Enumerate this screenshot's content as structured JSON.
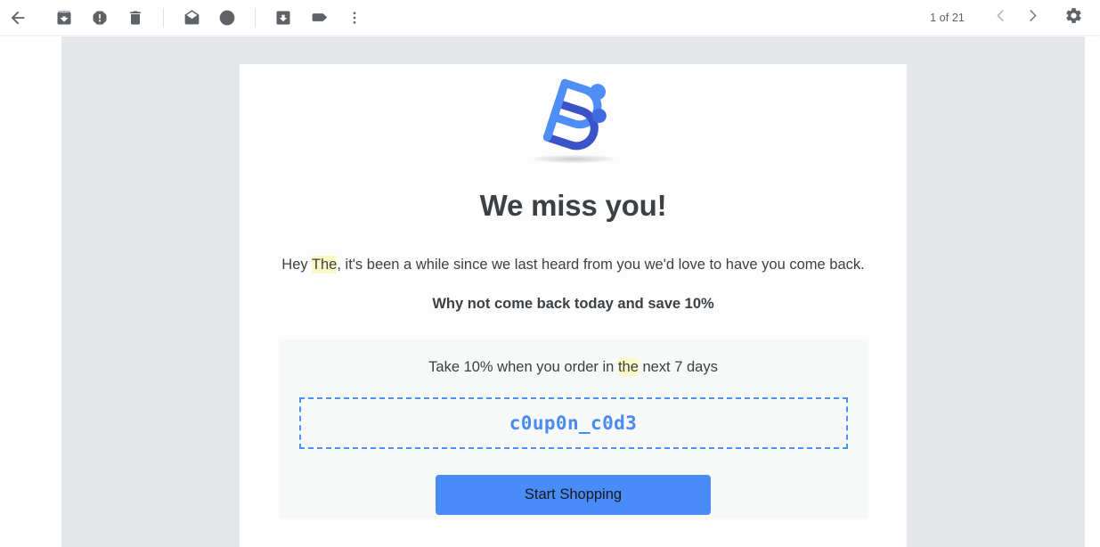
{
  "toolbar": {
    "back": {
      "label": "Back to Inbox",
      "icon": "arrow-left-icon"
    },
    "actions": [
      {
        "name": "archive",
        "label": "Archive",
        "icon": "archive-icon"
      },
      {
        "name": "report-spam",
        "label": "Report spam",
        "icon": "report-spam-icon"
      },
      {
        "name": "delete",
        "label": "Delete",
        "icon": "trash-icon"
      },
      {
        "name": "mark-unread",
        "label": "Mark as unread",
        "icon": "envelope-open-icon"
      },
      {
        "name": "snooze",
        "label": "Snooze",
        "icon": "clock-icon"
      },
      {
        "name": "move-to",
        "label": "Move to",
        "icon": "move-to-inbox-icon"
      },
      {
        "name": "labels",
        "label": "Labels",
        "icon": "label-tag-icon"
      },
      {
        "name": "more",
        "label": "More",
        "icon": "more-vertical-icon"
      }
    ],
    "pager": {
      "count_text": "1 of 21",
      "previous_label": "Older",
      "next_label": "Newer",
      "previous_icon": "chevron-left-icon",
      "next_icon": "chevron-right-icon"
    },
    "settings": {
      "label": "Settings",
      "icon": "gear-icon"
    }
  },
  "email": {
    "logo": {
      "name": "brand-logo",
      "alt": "Company B logo",
      "colors": {
        "light_blue": "#4f8ef7",
        "dark_blue": "#3a54c8",
        "mid_blue": "#4a7ae8"
      }
    },
    "headline": "We miss you!",
    "intro": {
      "before_highlight": "Hey ",
      "highlight": "The",
      "after_highlight": ", it's been a while since we last heard from you we'd love to have you come back."
    },
    "subheadline": "Why not come back today and save 10%",
    "offer": {
      "before_highlight": "Take 10% when you order in ",
      "highlight": "the",
      "after_highlight": " next 7 days",
      "coupon_code": "c0up0n_c0d3",
      "cta_label": "Start Shopping"
    }
  },
  "colors": {
    "accent_blue": "#4a8cf7",
    "coupon_border": "#4a90f0",
    "coupon_text": "#4a8bf0",
    "highlight_yellow": "#fcf8c8",
    "page_background": "#e4e6e9",
    "card_background": "#fdfdfd",
    "panel_background": "#f7f8f8",
    "text_primary": "#3c4043",
    "icon_gray": "#5f6368"
  }
}
